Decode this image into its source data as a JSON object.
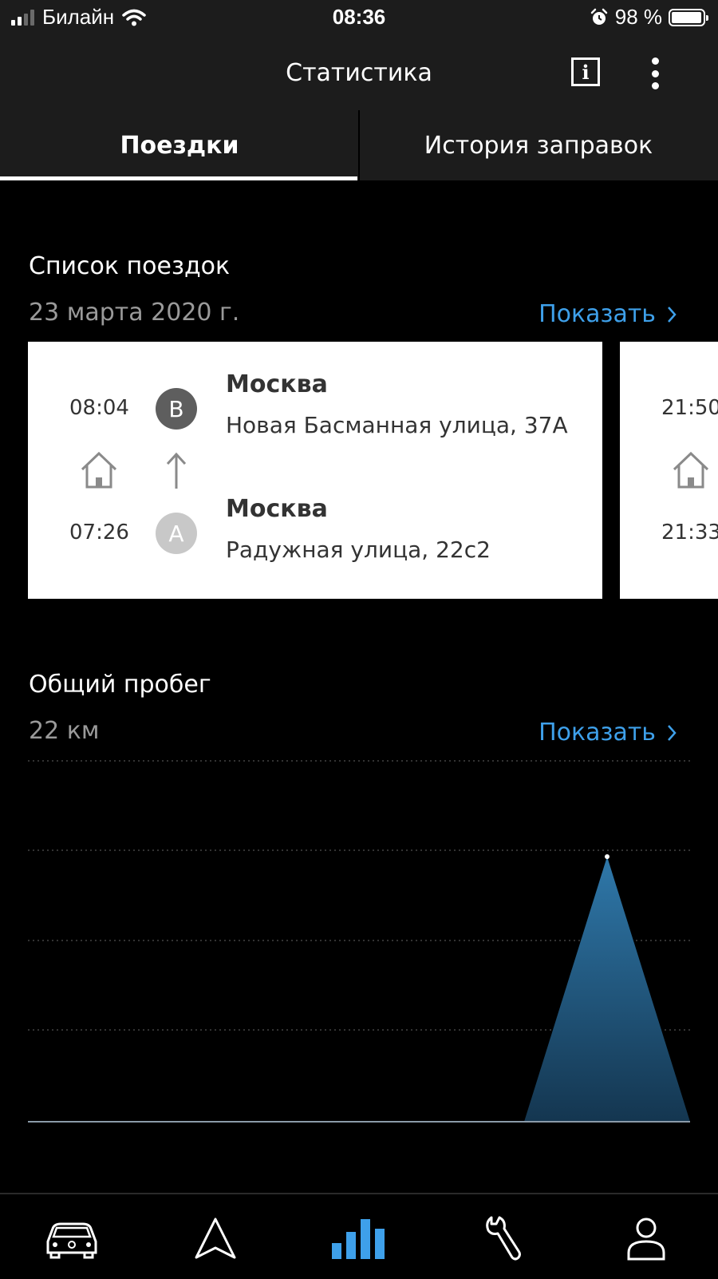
{
  "status_bar": {
    "carrier": "Билайн",
    "time": "08:36",
    "battery": "98 %",
    "battery_level": 0.98
  },
  "header": {
    "title": "Статистика",
    "info_icon": "info-icon",
    "more_icon": "more-vertical-icon"
  },
  "tabs": [
    {
      "label": "Поездки",
      "active": true
    },
    {
      "label": "История заправок",
      "active": false
    }
  ],
  "trips": {
    "title": "Список поездок",
    "date": "23 марта 2020 г.",
    "show_label": "Показать",
    "card": {
      "end_time": "08:04",
      "end_badge": "B",
      "end_city": "Москва",
      "end_street": "Новая Басманная улица, 37А",
      "start_time": "07:26",
      "start_badge": "A",
      "start_city": "Москва",
      "start_street": "Радужная улица, 22с2"
    },
    "next_card": {
      "end_time": "21:50",
      "start_time": "21:33"
    }
  },
  "mileage": {
    "title": "Общий пробег",
    "value": "22 км",
    "show_label": "Показать"
  },
  "colors": {
    "accent": "#3ea0ea",
    "header_bg": "#1c1c1c",
    "chart_fill": "#2b6a96"
  },
  "nav": [
    {
      "icon": "car-icon",
      "active": false
    },
    {
      "icon": "navigation-icon",
      "active": false
    },
    {
      "icon": "statistics-icon",
      "active": true
    },
    {
      "icon": "wrench-icon",
      "active": false
    },
    {
      "icon": "profile-icon",
      "active": false
    }
  ]
}
